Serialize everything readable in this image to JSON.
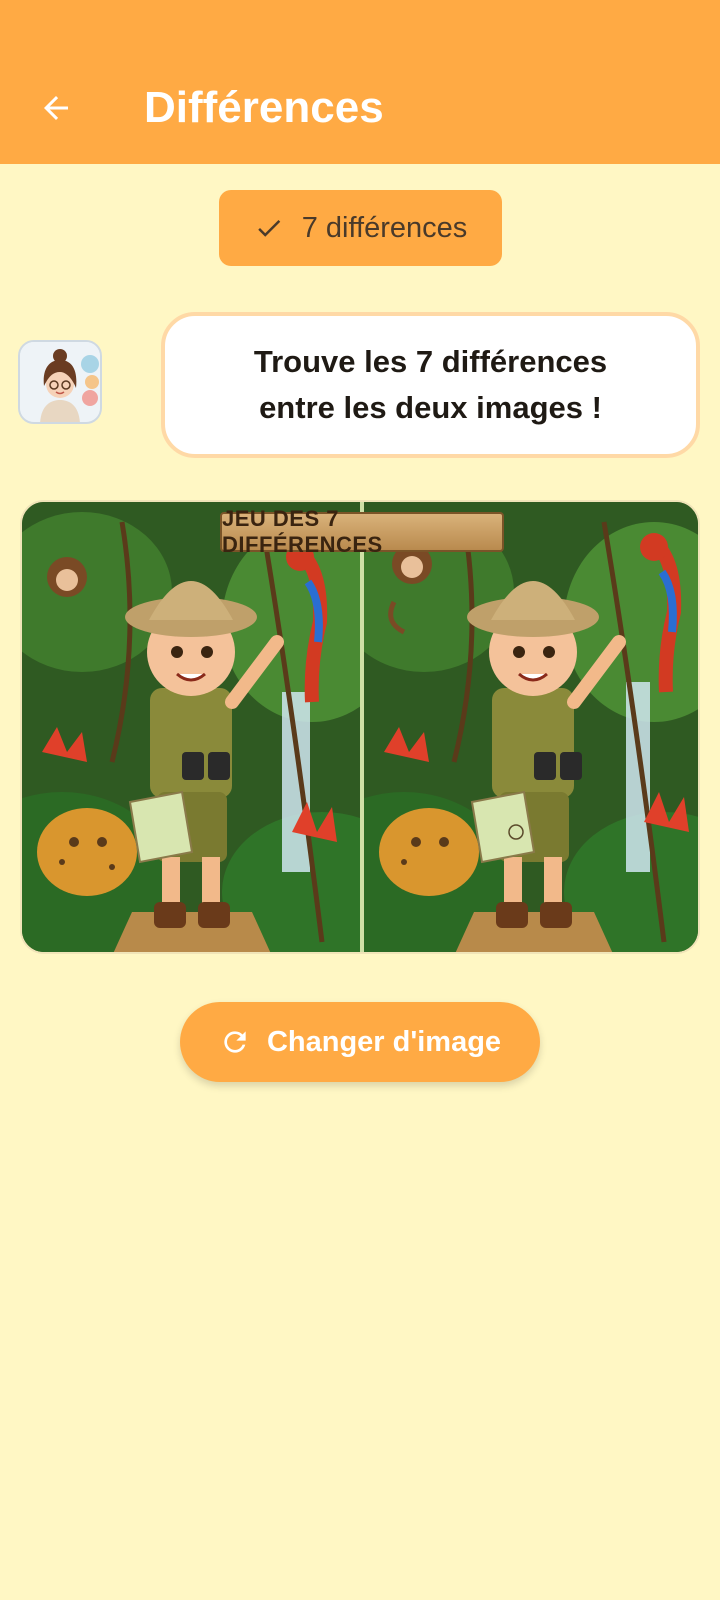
{
  "app_bar": {
    "title": "Différences",
    "back_icon": "arrow-left-icon",
    "background": "#FFAA44"
  },
  "counter": {
    "label": "7 différences",
    "icon": "check-icon"
  },
  "instructions": {
    "avatar_icon": "teacher-avatar-icon",
    "line1": "Trouve les 7 différences",
    "line2": "entre les deux images !"
  },
  "game_image": {
    "sign_text": "JEU DES 7 DIFFÉRENCES"
  },
  "change_button": {
    "label": "Changer d'image",
    "icon": "refresh-icon"
  },
  "colors": {
    "accent": "#FFAA44",
    "background": "#FFF7C4",
    "bubble_border": "#FFD9A6"
  }
}
